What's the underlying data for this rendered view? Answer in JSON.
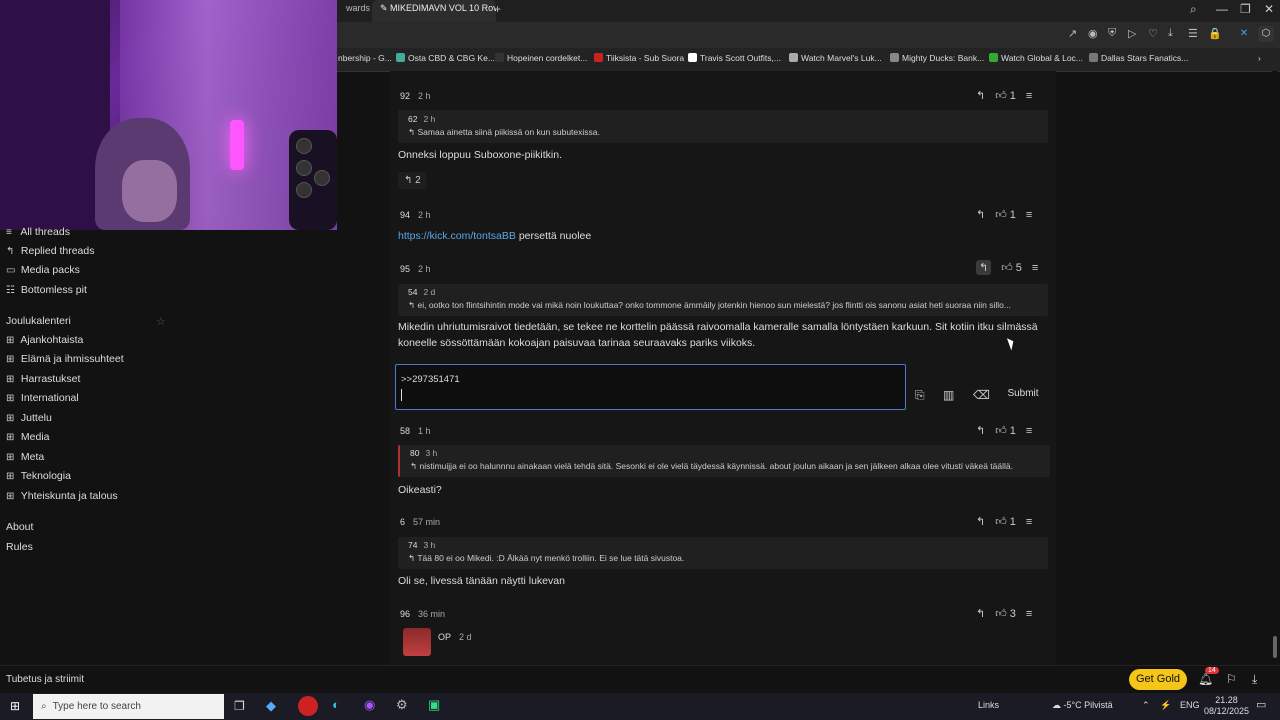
{
  "browser": {
    "tabs": [
      {
        "label": "wards",
        "active": false
      },
      {
        "label": "MIKEDIMAVN VOL 10 Rov",
        "active": true
      }
    ],
    "new_tab": "+",
    "bookmarks": [
      {
        "label": "nbership - G...",
        "color": "#888"
      },
      {
        "label": "Osta CBD & CBG Ke...",
        "color": "#4a9"
      },
      {
        "label": "Hopeinen cordelket...",
        "color": "#222"
      },
      {
        "label": "Tiiksista - Sub Suora",
        "color": "#c22"
      },
      {
        "label": "Travis Scott Outfits,...",
        "color": "#fff"
      },
      {
        "label": "Watch Marvel's Luk...",
        "color": "#aaa"
      },
      {
        "label": "Mighty Ducks: Bank...",
        "color": "#888"
      },
      {
        "label": "Watch Global & Loc...",
        "color": "#3a3"
      },
      {
        "label": "Dallas Stars Fanatics...",
        "color": "#777"
      }
    ],
    "links_label": "Links"
  },
  "sidebar": {
    "items": [
      {
        "label": "All threads",
        "icon": "list-icon"
      },
      {
        "label": "Replied threads",
        "icon": "reply-icon"
      },
      {
        "label": "Media packs",
        "icon": "media-icon"
      },
      {
        "label": "Bottomless pit",
        "icon": "pit-icon"
      }
    ],
    "section_title": "Joulukalenteri",
    "boards": [
      "Ajankohtaista",
      "Elämä ja ihmissuhteet",
      "Harrastukset",
      "International",
      "Juttelu",
      "Media",
      "Meta",
      "Teknologia",
      "Yhteiskunta ja talous"
    ],
    "about": "About",
    "rules": "Rules",
    "footer": "Tubetus ja striimit"
  },
  "posts": [
    {
      "num": "92",
      "time": "2 h",
      "likes": "1",
      "quote": {
        "num": "62",
        "time": "2 h",
        "text": "Samaa ainetta siinä piikissä on kun subutexissa."
      },
      "body": "Onneksi loppuu Suboxone-piikitkin.",
      "replies": "2"
    },
    {
      "num": "94",
      "time": "2 h",
      "likes": "1",
      "link": "https://kick.com/tontsaBB",
      "body": "persettä nuolee"
    },
    {
      "num": "95",
      "time": "2 h",
      "likes": "5",
      "quote": {
        "num": "54",
        "time": "2 d",
        "text": "ei, ootko ton flintsihintin mode vai mikä noin loukuttaa? onko tommone ämmäily jotenkin hienoo sun mielestä? jos flintti ois sanonu asiat heti suoraa niin sillo..."
      },
      "body_line1": "Mikedin uhriutumisraivot tiedetään, se tekee ne korttelin päässä raivoomalla kameralle samalla löntystäen karkuun. Sit kotiin itku silmässä",
      "body_line2": "koneelle sössöttämään kokoajan paisuvaa tarinaa seuraavaks pariks viikoks."
    },
    {
      "num": "58",
      "time": "1 h",
      "likes": "1",
      "quote": {
        "num": "80",
        "time": "3 h",
        "text": "nistimuijja ei oo halunnnu ainakaan vielä tehdä sitä. Sesonki ei ole vielä täydessä käynnissä. about joulun aikaan ja sen jälkeen alkaa olee vitusti väkeä täällä."
      },
      "body": "Oikeasti?"
    },
    {
      "num": "6",
      "time": "57 min",
      "likes": "1",
      "quote": {
        "num": "74",
        "time": "3 h",
        "text": "Tää 80 ei oo Mikedi. :D Älkää nyt menkö trolliin. Ei se lue tätä sivustoa."
      },
      "body": "Oli se, livessä tänään näytti lukevan"
    },
    {
      "num": "96",
      "time": "36 min",
      "likes": "3",
      "op_label": "OP",
      "op_time": "2 d"
    }
  ],
  "compose": {
    "text": ">>297351471",
    "submit": "Submit"
  },
  "get_gold": "Get Gold",
  "notifications": "14",
  "taskbar": {
    "search_placeholder": "Type here to search",
    "weather": "-5°C  Pilvistä",
    "lang": "ENG",
    "time": "21.28",
    "date": "08/12/2025"
  }
}
